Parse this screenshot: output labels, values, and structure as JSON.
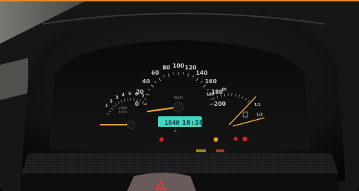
{
  "photo": {
    "subject": "car-instrument-cluster"
  },
  "speedometer": {
    "unit": "km/h",
    "ticks": [
      "0",
      "20",
      "40",
      "60",
      "80",
      "100",
      "120",
      "140",
      "160",
      "180",
      "200"
    ]
  },
  "tachometer": {
    "ticks": [
      "1",
      "2",
      "3",
      "4",
      "5",
      "6",
      "7"
    ],
    "multiplier": "x1000",
    "unit": "1/min"
  },
  "temperature_gauge": {
    "ticks": [
      "120",
      "80"
    ]
  },
  "fuel_gauge": {
    "ticks": [
      "1/1",
      "1/2"
    ]
  },
  "lcd_display": {
    "odometer": "1840",
    "clock": "16:38"
  },
  "colors": {
    "lcd_background": "#3fd8c4",
    "needle": "#e0a040",
    "warning_red": "#e02020",
    "warning_amber": "#e0a020",
    "frame_accent": "#e8892a"
  }
}
